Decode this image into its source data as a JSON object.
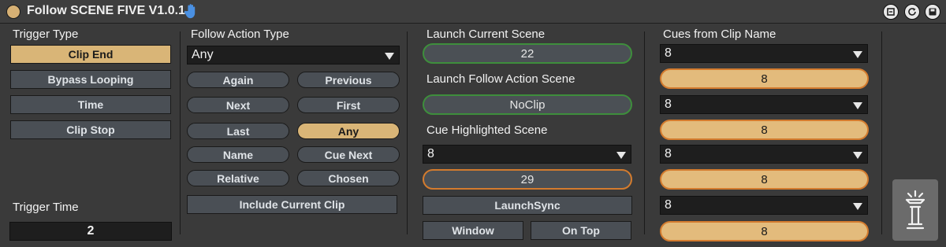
{
  "title": "Follow SCENE FIVE V1.0.1",
  "colors": {
    "accent": "#d9b577",
    "green_outline": "#3e8e3c",
    "orange_outline": "#d37b2e"
  },
  "icons": [
    "hand-icon",
    "circle-icon",
    "freeze-icon",
    "refresh-icon",
    "save-icon",
    "lamp-logo-icon"
  ],
  "trigger": {
    "type_label": "Trigger Type",
    "buttons": [
      "Clip End",
      "Bypass Looping",
      "Time",
      "Clip Stop"
    ],
    "active": "Clip End",
    "time_label": "Trigger Time",
    "time_value": "2"
  },
  "follow_action": {
    "label": "Follow Action Type",
    "dropdown_value": "Any",
    "pills": [
      "Again",
      "Previous",
      "Next",
      "First",
      "Last",
      "Any",
      "Name",
      "Cue Next",
      "Relative",
      "Chosen"
    ],
    "active": "Any",
    "include_label": "Include Current Clip"
  },
  "launch": {
    "current_label": "Launch Current Scene",
    "current_value": "22",
    "follow_label": "Launch Follow Action Scene",
    "follow_value": "NoClip",
    "cue_label": "Cue Highlighted Scene",
    "cue_dropdown": "8",
    "cue_value": "29",
    "sync_label": "LaunchSync",
    "window_label": "Window",
    "ontop_label": "On Top"
  },
  "cues": {
    "label": "Cues from Clip Name",
    "rows": [
      {
        "dropdown": "8",
        "value": "8"
      },
      {
        "dropdown": "8",
        "value": "8"
      },
      {
        "dropdown": "8",
        "value": "8"
      },
      {
        "dropdown": "8",
        "value": "8"
      }
    ]
  }
}
